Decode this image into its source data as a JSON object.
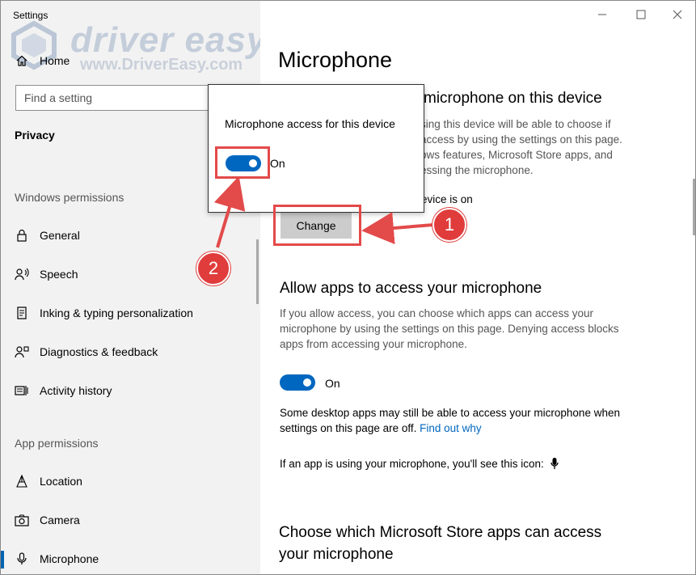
{
  "window": {
    "title": "Settings",
    "minimize_icon": "minimize-icon",
    "maximize_icon": "maximize-icon",
    "close_icon": "close-icon"
  },
  "watermark": {
    "brand": "driver easy",
    "url": "www.DriverEasy.com"
  },
  "sidebar": {
    "home_label": "Home",
    "search_placeholder": "Find a setting",
    "category": "Privacy",
    "windows_permissions_header": "Windows permissions",
    "windows_permissions": [
      {
        "label": "General",
        "icon": "lock-icon"
      },
      {
        "label": "Speech",
        "icon": "speech-icon"
      },
      {
        "label": "Inking & typing personalization",
        "icon": "inking-icon"
      },
      {
        "label": "Diagnostics & feedback",
        "icon": "diagnostics-icon"
      },
      {
        "label": "Activity history",
        "icon": "activity-icon"
      }
    ],
    "app_permissions_header": "App permissions",
    "app_permissions": [
      {
        "label": "Location",
        "icon": "location-icon"
      },
      {
        "label": "Camera",
        "icon": "camera-icon"
      },
      {
        "label": "Microphone",
        "icon": "microphone-icon",
        "selected": true
      }
    ]
  },
  "main": {
    "title": "Microphone",
    "device_section": {
      "heading_partial": "microphone on this device",
      "desc_lines": [
        "sing this device will be able to choose if",
        "access by using the settings on this page.",
        "ows features, Microsoft Store apps, and",
        "essing the microphone."
      ],
      "status_partial": "evice is on",
      "change_label": "Change"
    },
    "apps_section": {
      "heading": "Allow apps to access your microphone",
      "desc_lines": [
        "If you allow access, you can choose which apps can access your",
        "microphone by using the settings on this page. Denying access blocks",
        "apps from accessing your microphone."
      ],
      "toggle_state": "On",
      "note_lines": [
        "Some desktop apps may still be able to access your microphone when",
        "settings on this page are off."
      ],
      "link": "Find out why",
      "icon_note": "If an app is using your microphone, you'll see this icon:"
    },
    "store_section": {
      "heading_lines": [
        "Choose which Microsoft Store apps can access",
        "your microphone"
      ]
    }
  },
  "popup": {
    "title": "Microphone access for this device",
    "toggle_state": "On"
  },
  "annotations": {
    "step1": "1",
    "step2": "2",
    "color": "#e34a4a"
  },
  "colors": {
    "accent": "#0067c0",
    "sidebar_bg": "#f2f2f2",
    "selection": "#0063b1"
  }
}
